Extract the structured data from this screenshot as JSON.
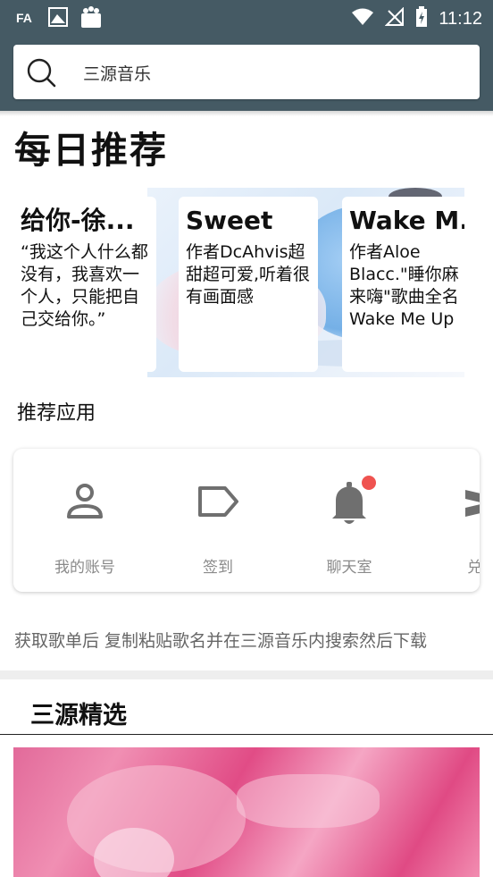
{
  "status_bar": {
    "time": "11:12",
    "left_icons": [
      "keyboard-icon",
      "gallery-icon",
      "shopping-bag-icon"
    ],
    "right_icons": [
      "wifi-icon",
      "no-signal-icon",
      "battery-charging-icon"
    ]
  },
  "search": {
    "text": "三源音乐",
    "icon": "search-icon"
  },
  "daily": {
    "title": "每日推荐",
    "cards": [
      {
        "title": "给你-徐...",
        "desc": "“我这个人什么都没有，我喜欢一个人，只能把自己交给你。”"
      },
      {
        "title": "Sweet",
        "desc": "作者DcAhvis超甜超可爱,听着很有画面感"
      },
      {
        "title": "Wake M...",
        "desc": "作者Aloe Blacc.\"睡你麻来嗨\"歌曲全名Wake Me Up"
      }
    ]
  },
  "apps": {
    "title": "推荐应用",
    "items": [
      {
        "label": "我的账号",
        "icon": "account-icon"
      },
      {
        "label": "签到",
        "icon": "tag-icon"
      },
      {
        "label": "聊天室",
        "icon": "bell-icon",
        "badge_color": "#ef5350"
      },
      {
        "label": "兑换",
        "icon": "exchange-icon"
      }
    ]
  },
  "hint": "获取歌单后 复制粘贴歌名并在三源音乐内搜索然后下载",
  "picks": {
    "title": "三源精选"
  },
  "colors": {
    "header": "#455a64",
    "icon_gray": "#6f6f6f",
    "badge": "#ef5350"
  }
}
